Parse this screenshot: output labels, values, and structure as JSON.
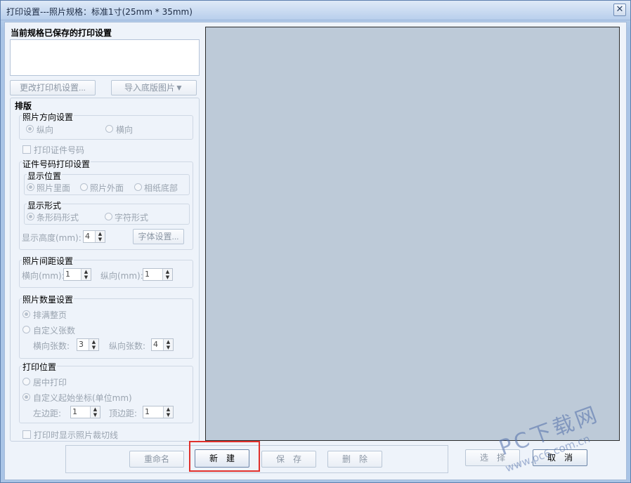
{
  "window": {
    "title": "打印设置---照片规格：标准1寸(25mm * 35mm)",
    "close_glyph": "✕"
  },
  "saved": {
    "title": "当前规格已保存的打印设置"
  },
  "buttons": {
    "change_printer": "更改打印机设置...",
    "import_bg": "导入底版图片▼",
    "font_settings": "字体设置...",
    "rename": "重命名",
    "new": "新　建",
    "save": "保　存",
    "delete": "删　除",
    "select": "选　择",
    "cancel": "取　消"
  },
  "layout_panel": {
    "title": "排版",
    "orientation": {
      "title": "照片方向设置",
      "portrait": "纵向",
      "landscape": "横向"
    },
    "print_id_label": "打印证件号码",
    "id_settings": {
      "title": "证件号码打印设置",
      "position": {
        "title": "显示位置",
        "inside": "照片里面",
        "outside": "照片外面",
        "bottom": "相纸底部"
      },
      "format": {
        "title": "显示形式",
        "barcode": "条形码形式",
        "text": "字符形式"
      },
      "height_label": "显示高度(mm):",
      "height_value": "4"
    },
    "spacing": {
      "title": "照片间距设置",
      "h_label": "横向(mm):",
      "h_value": "1",
      "v_label": "纵向(mm):",
      "v_value": "1"
    },
    "count": {
      "title": "照片数量设置",
      "fill_page": "排满整页",
      "custom": "自定义张数",
      "h_label": "横向张数:",
      "h_value": "3",
      "v_label": "纵向张数:",
      "v_value": "4"
    },
    "print_pos": {
      "title": "打印位置",
      "center": "居中打印",
      "custom": "自定义起始坐标(单位mm)",
      "left_label": "左边距:",
      "left_value": "1",
      "top_label": "顶边距:",
      "top_value": "1"
    },
    "crop_lines_label": "打印时显示照片裁切线"
  },
  "watermark": {
    "text": "PC下载网",
    "url": "www.pc6.com.cn"
  }
}
